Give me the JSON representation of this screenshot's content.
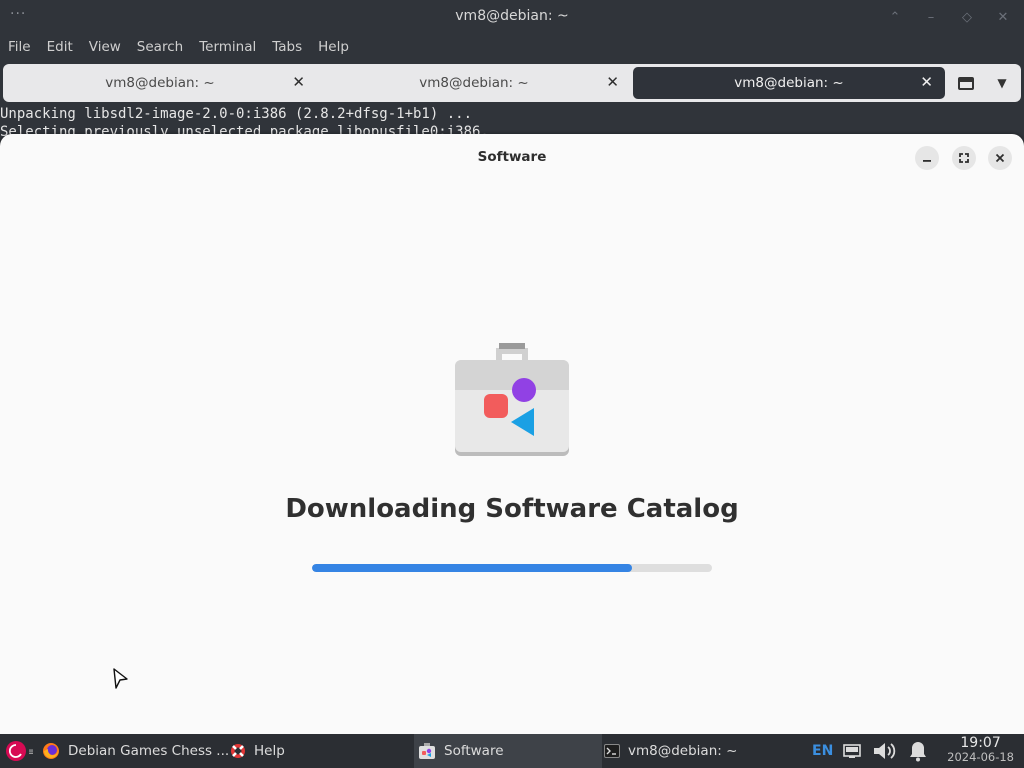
{
  "terminal": {
    "title": "vm8@debian: ~",
    "menu": [
      "File",
      "Edit",
      "View",
      "Search",
      "Terminal",
      "Tabs",
      "Help"
    ],
    "tabs": [
      {
        "label": "vm8@debian: ~"
      },
      {
        "label": "vm8@debian: ~"
      },
      {
        "label": "vm8@debian: ~"
      }
    ],
    "output_lines": [
      "Unpacking libsdl2-image-2.0-0:i386 (2.8.2+dfsg-1+b1) ...",
      "Selecting previously unselected package libopusfile0:i386."
    ]
  },
  "software": {
    "title": "Software",
    "heading": "Downloading Software Catalog",
    "progress_fraction": 0.8,
    "colors": {
      "accent": "#3584e4",
      "red": "#f25c5c",
      "purple": "#9141e4",
      "blue": "#1aa0e4"
    }
  },
  "taskbar": {
    "items": [
      {
        "label": "Debian Games Chess ..."
      },
      {
        "label": "Help"
      },
      {
        "label": "Software"
      },
      {
        "label": "vm8@debian: ~"
      }
    ],
    "language": "EN",
    "time": "19:07",
    "date": "2024-06-18"
  }
}
